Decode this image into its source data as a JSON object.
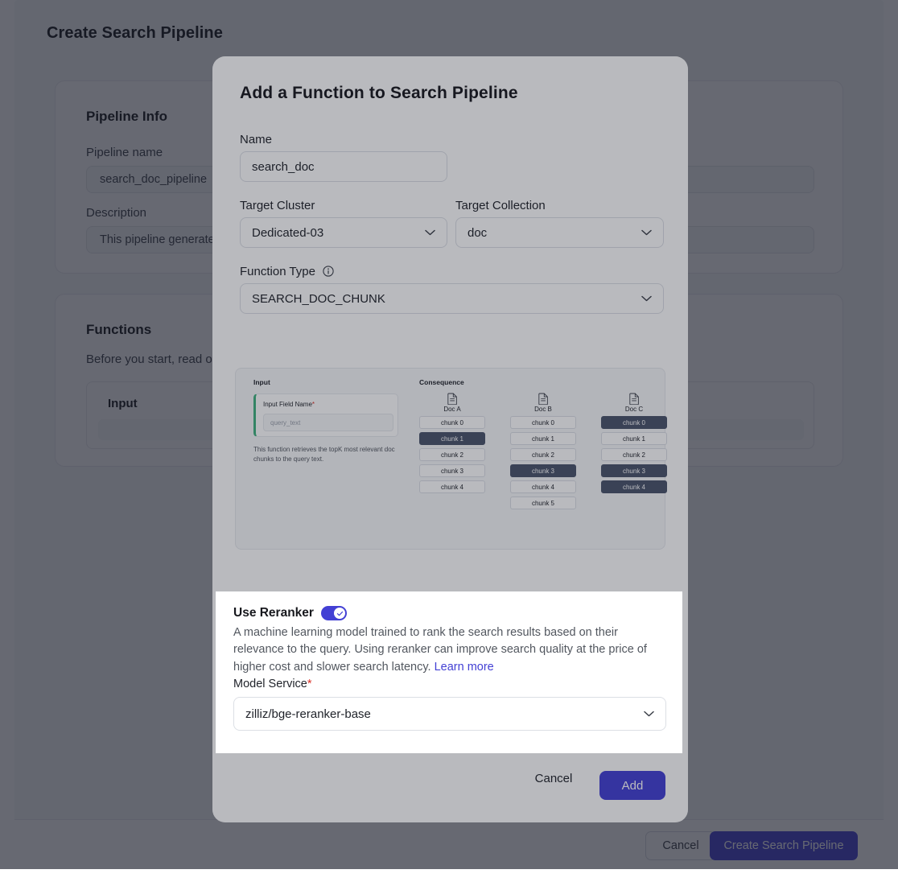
{
  "background": {
    "title": "Create Search Pipeline",
    "pipeline_info": {
      "heading": "Pipeline Info",
      "name_label": "Pipeline name",
      "name_value": "search_doc_pipeline",
      "description_label": "Description",
      "description_value": "This pipeline generates"
    },
    "functions": {
      "heading": "Functions",
      "subtitle": "Before you start, read our",
      "column_input": "Input"
    },
    "footer": {
      "cancel_label": "Cancel",
      "primary_label": "Create Search Pipeline"
    }
  },
  "modal": {
    "title": "Add a Function to Search Pipeline",
    "name": {
      "label": "Name",
      "value": "search_doc"
    },
    "target_cluster": {
      "label": "Target Cluster",
      "value": "Dedicated-03"
    },
    "target_collection": {
      "label": "Target Collection",
      "value": "doc"
    },
    "function_type": {
      "label": "Function Type",
      "value": "SEARCH_DOC_CHUNK"
    },
    "illustration": {
      "input_heading": "Input",
      "consequence_heading": "Consequence",
      "input_field_label": "Input Field Name",
      "input_field_required": "*",
      "input_field_placeholder": "query_text",
      "description": "This function retrieves the topK most relevant doc chunks to the query text.",
      "docs": [
        {
          "name": "Doc A",
          "chunks": [
            {
              "label": "chunk 0",
              "highlighted": false
            },
            {
              "label": "chunk 1",
              "highlighted": true
            },
            {
              "label": "chunk 2",
              "highlighted": false
            },
            {
              "label": "chunk 3",
              "highlighted": false
            },
            {
              "label": "chunk 4",
              "highlighted": false
            }
          ]
        },
        {
          "name": "Doc B",
          "chunks": [
            {
              "label": "chunk 0",
              "highlighted": false
            },
            {
              "label": "chunk 1",
              "highlighted": false
            },
            {
              "label": "chunk 2",
              "highlighted": false
            },
            {
              "label": "chunk 3",
              "highlighted": true
            },
            {
              "label": "chunk 4",
              "highlighted": false
            },
            {
              "label": "chunk 5",
              "highlighted": false
            }
          ]
        },
        {
          "name": "Doc C",
          "chunks": [
            {
              "label": "chunk 0",
              "highlighted": true
            },
            {
              "label": "chunk 1",
              "highlighted": false
            },
            {
              "label": "chunk 2",
              "highlighted": false
            },
            {
              "label": "chunk 3",
              "highlighted": true
            },
            {
              "label": "chunk 4",
              "highlighted": true
            }
          ]
        }
      ]
    },
    "reranker": {
      "title": "Use Reranker",
      "enabled": true,
      "description": "A machine learning model trained to rank the search results based on their relevance to the query. Using reranker can improve search quality at the price of higher cost and slower search latency. ",
      "learn_more": "Learn more",
      "model_service_label": "Model Service",
      "model_service_required": "*",
      "model_service_value": "zilliz/bge-reranker-base"
    },
    "footer": {
      "cancel_label": "Cancel",
      "add_label": "Add"
    }
  },
  "colors": {
    "accent": "#4340d4",
    "required": "#d93026",
    "chunk_highlight": "#49536a",
    "input_accent": "#3fb27f"
  }
}
